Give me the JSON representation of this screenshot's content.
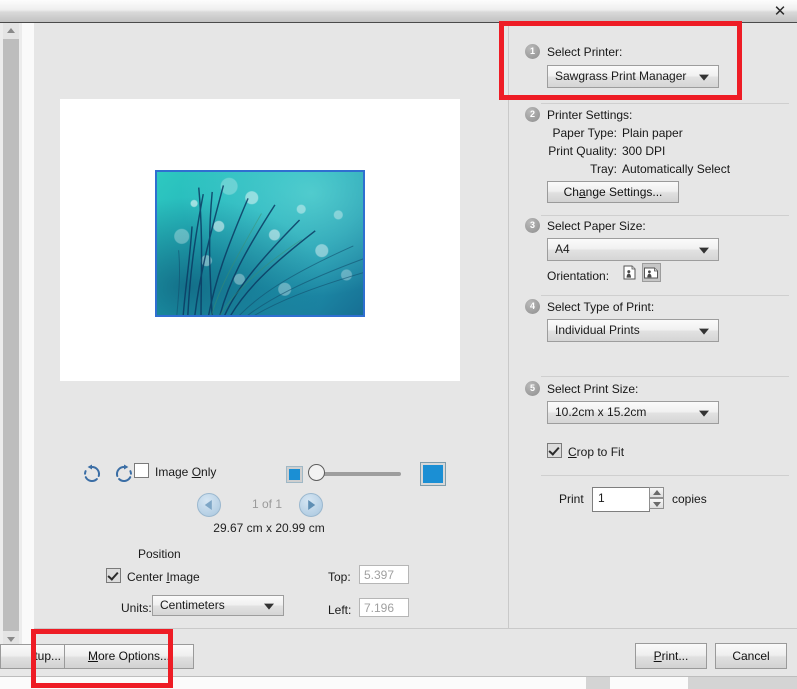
{
  "window": {
    "close_label": "✕"
  },
  "preview": {
    "paper_background": "#ffffff",
    "image_border_color": "#2f6fd0",
    "rotate_left_icon": "rotate-counterclockwise-icon",
    "rotate_right_icon": "rotate-clockwise-icon",
    "image_only_label_pre": "Image ",
    "image_only_accel": "O",
    "image_only_label_post": "nly",
    "image_only_checked": false,
    "zoom_out_icon": "zoom-out-small-square-icon",
    "zoom_in_icon": "zoom-in-large-square-icon",
    "page_count": "1 of 1",
    "dimensions": "29.67 cm x 20.99 cm",
    "position_label": "Position",
    "center_image_label_pre": "Center ",
    "center_image_accel": "I",
    "center_image_label_post": "mage",
    "center_image_checked": true,
    "units_label": "Units:",
    "units_value": "Centimeters",
    "top_label": "Top:",
    "top_value": "5.397",
    "left_label": "Left:",
    "left_value": "7.196"
  },
  "options": {
    "step1": {
      "number": "1",
      "title": "Select Printer:",
      "printer_value": "Sawgrass Print Manager"
    },
    "step2": {
      "number": "2",
      "title": "Printer Settings:",
      "rows": [
        {
          "label": "Paper Type:",
          "value": "Plain paper"
        },
        {
          "label": "Print Quality:",
          "value": "300 DPI"
        },
        {
          "label": "Tray:",
          "value": "Automatically Select"
        }
      ],
      "change_settings_pre": "Ch",
      "change_settings_accel": "a",
      "change_settings_post": "nge Settings..."
    },
    "step3": {
      "number": "3",
      "title": "Select Paper Size:",
      "paper_size_value": "A4",
      "orientation_label": "Orientation:",
      "portrait_icon": "portrait-orientation-icon",
      "landscape_icon": "landscape-orientation-icon",
      "selected_orientation": "landscape"
    },
    "step4": {
      "number": "4",
      "title": "Select Type of Print:",
      "type_value": "Individual Prints"
    },
    "step5": {
      "number": "5",
      "title": "Select Print Size:",
      "print_size_value": "10.2cm x 15.2cm",
      "crop_to_fit_accel": "C",
      "crop_to_fit_post": "rop to Fit",
      "crop_to_fit_checked": true
    },
    "copies": {
      "print_label": "Print",
      "count_value": "1",
      "copies_label": "copies"
    }
  },
  "buttonbar": {
    "setup_label": "tup...",
    "more_options_accel": "M",
    "more_options_post": "ore Options...",
    "print_accel": "P",
    "print_post": "rint...",
    "cancel_label": "Cancel"
  },
  "annotations": {
    "highlight_color": "#ee1c25",
    "boxes": [
      "select-printer-region",
      "more-options-region"
    ]
  }
}
